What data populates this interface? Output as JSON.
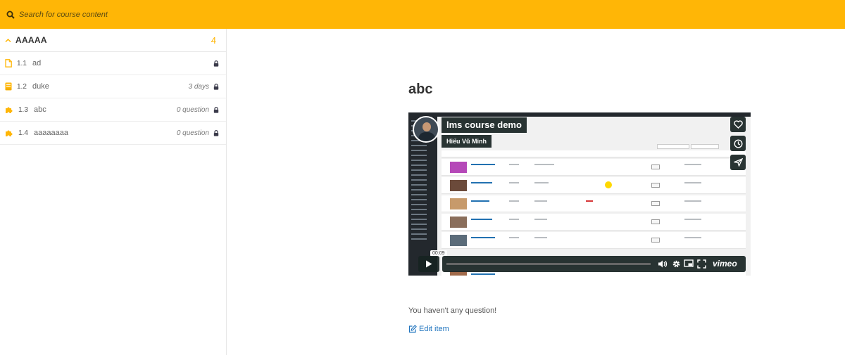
{
  "search": {
    "placeholder": "Search for course content"
  },
  "section": {
    "title": "AAAAA",
    "count": "4"
  },
  "items": [
    {
      "number": "1.1",
      "label": "ad",
      "meta": "",
      "icon": "document-icon"
    },
    {
      "number": "1.2",
      "label": "duke",
      "meta": "3 days",
      "icon": "book-icon"
    },
    {
      "number": "1.3",
      "label": "abc",
      "meta": "0 question",
      "icon": "puzzle-icon"
    },
    {
      "number": "1.4",
      "label": "aaaaaaaa",
      "meta": "0 question",
      "icon": "puzzle-icon"
    }
  ],
  "main": {
    "title": "abc",
    "video": {
      "title": "lms course demo",
      "author": "Hiếu Vũ Minh",
      "time": "00:09",
      "brand": "vimeo"
    },
    "no_question_text": "You haven't any question!",
    "edit_label": "Edit item"
  },
  "colors": {
    "accent": "#ffb606",
    "link": "#1e73be",
    "overlay": "#172322"
  }
}
